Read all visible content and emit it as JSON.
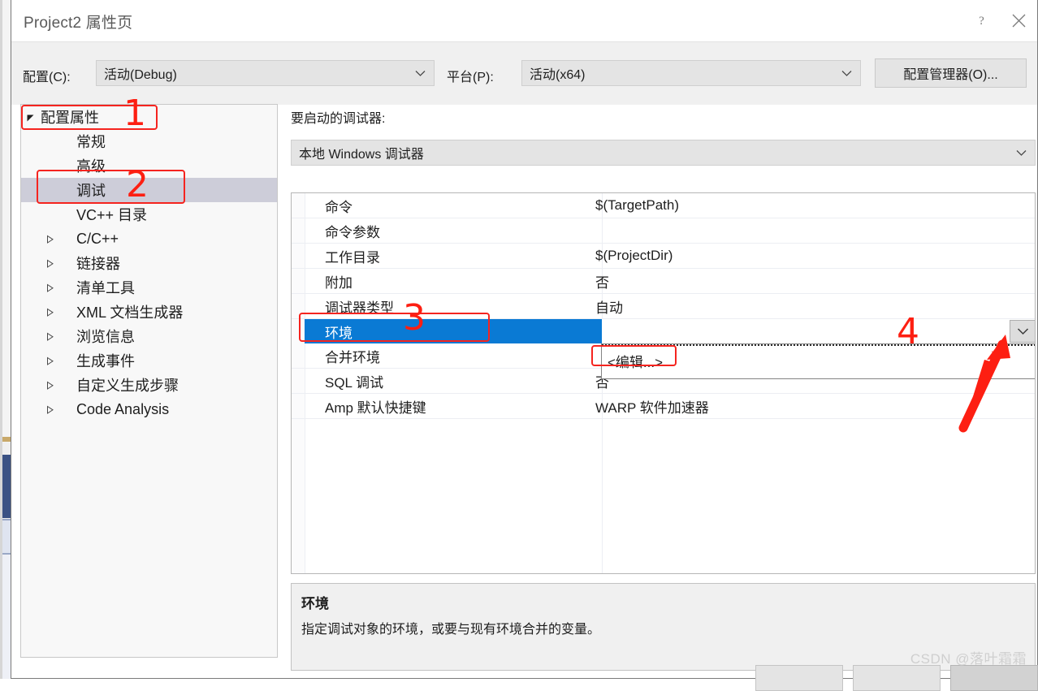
{
  "window": {
    "title": "Project2 属性页",
    "help_icon": "question-mark-icon",
    "close_icon": "close-icon"
  },
  "config_bar": {
    "configuration_label": "配置(C):",
    "configuration_value": "活动(Debug)",
    "platform_label": "平台(P):",
    "platform_value": "活动(x64)",
    "config_manager_button": "配置管理器(O)..."
  },
  "tree": {
    "items": [
      {
        "label": "配置属性",
        "level": 0,
        "expander": "expanded",
        "selected": false
      },
      {
        "label": "常规",
        "level": 1,
        "expander": "none",
        "selected": false
      },
      {
        "label": "高级",
        "level": 1,
        "expander": "none",
        "selected": false
      },
      {
        "label": "调试",
        "level": 1,
        "expander": "none",
        "selected": true
      },
      {
        "label": "VC++ 目录",
        "level": 1,
        "expander": "none",
        "selected": false
      },
      {
        "label": "C/C++",
        "level": 1,
        "expander": "collapsed",
        "selected": false
      },
      {
        "label": "链接器",
        "level": 1,
        "expander": "collapsed",
        "selected": false
      },
      {
        "label": "清单工具",
        "level": 1,
        "expander": "collapsed",
        "selected": false
      },
      {
        "label": "XML 文档生成器",
        "level": 1,
        "expander": "collapsed",
        "selected": false
      },
      {
        "label": "浏览信息",
        "level": 1,
        "expander": "collapsed",
        "selected": false
      },
      {
        "label": "生成事件",
        "level": 1,
        "expander": "collapsed",
        "selected": false
      },
      {
        "label": "自定义生成步骤",
        "level": 1,
        "expander": "collapsed",
        "selected": false
      },
      {
        "label": "Code Analysis",
        "level": 1,
        "expander": "collapsed",
        "selected": false
      }
    ]
  },
  "pane": {
    "caption": "要启动的调试器:",
    "debugger_value": "本地 Windows 调试器",
    "rows": [
      {
        "name": "命令",
        "value": "$(TargetPath)",
        "selected": false
      },
      {
        "name": "命令参数",
        "value": "",
        "selected": false
      },
      {
        "name": "工作目录",
        "value": "$(ProjectDir)",
        "selected": false
      },
      {
        "name": "附加",
        "value": "否",
        "selected": false
      },
      {
        "name": "调试器类型",
        "value": "自动",
        "selected": false
      },
      {
        "name": "环境",
        "value": "",
        "selected": true
      },
      {
        "name": "合并环境",
        "value": "",
        "selected": false
      },
      {
        "name": "SQL 调试",
        "value": "否",
        "selected": false
      },
      {
        "name": "Amp 默认快捷键",
        "value": "WARP 软件加速器",
        "selected": false
      }
    ],
    "dropdown": {
      "open": true,
      "toggle_icon": "chevron-down-icon",
      "options": [
        "<编辑...>"
      ]
    }
  },
  "description": {
    "title": "环境",
    "text": "指定调试对象的环境，或要与现有环境合并的变量。"
  },
  "footer": {
    "buttons": [
      "",
      "",
      ""
    ]
  },
  "watermark": "CSDN @落叶霜霜",
  "annotations": {
    "color": "#fd1f12",
    "markers": [
      {
        "id": "1",
        "target": "配置属性"
      },
      {
        "id": "2",
        "target": "调试"
      },
      {
        "id": "3",
        "target": "环境"
      },
      {
        "id": "4",
        "target": "dropdown-toggle"
      }
    ],
    "arrow": {
      "from": "4",
      "to": "dropdown-toggle"
    }
  }
}
